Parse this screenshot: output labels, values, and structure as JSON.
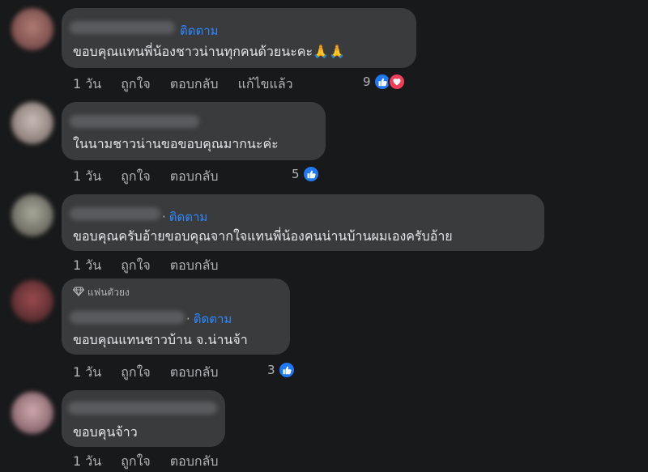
{
  "comments": [
    {
      "follow": "ติดตาม",
      "text": "ขอบคุณแทนพี่น้องชาวน่านทุกคนด้วยนะคะ🙏🙏",
      "actions": [
        "1 วัน",
        "ถูกใจ",
        "ตอบกลับ",
        "แก้ไขแล้ว"
      ],
      "reaction_count": "9",
      "reactions": [
        "like-icon",
        "love-icon"
      ]
    },
    {
      "text": "ในนามชาวน่านขอขอบคุณมากนะค่ะ",
      "actions": [
        "1 วัน",
        "ถูกใจ",
        "ตอบกลับ"
      ],
      "reaction_count": "5",
      "reactions": [
        "like-icon"
      ]
    },
    {
      "follow": "ติดตาม",
      "text": "ขอบคุณครับอ้ายขอบคุณจากใจแทนพี่น้องคนน่านบ้านผมเองครับอ้าย",
      "actions": [
        "1 วัน",
        "ถูกใจ",
        "ตอบกลับ"
      ]
    },
    {
      "badge": "แฟนตัวยง",
      "follow": "ติดตาม",
      "text": "ขอบคุณแทนชาวบ้าน จ.น่านจ้า",
      "actions": [
        "1 วัน",
        "ถูกใจ",
        "ตอบกลับ"
      ],
      "reaction_count": "3",
      "reactions": [
        "like-icon"
      ]
    },
    {
      "text": "ขอบคุนจ้าว",
      "actions": [
        "1 วัน",
        "ถูกใจ",
        "ตอบกลับ"
      ]
    }
  ],
  "colors": {
    "background": "#18191a",
    "bubble": "#3a3b3c",
    "link": "#2d88ff",
    "like": "#2078f4",
    "love": "#f33e58"
  }
}
